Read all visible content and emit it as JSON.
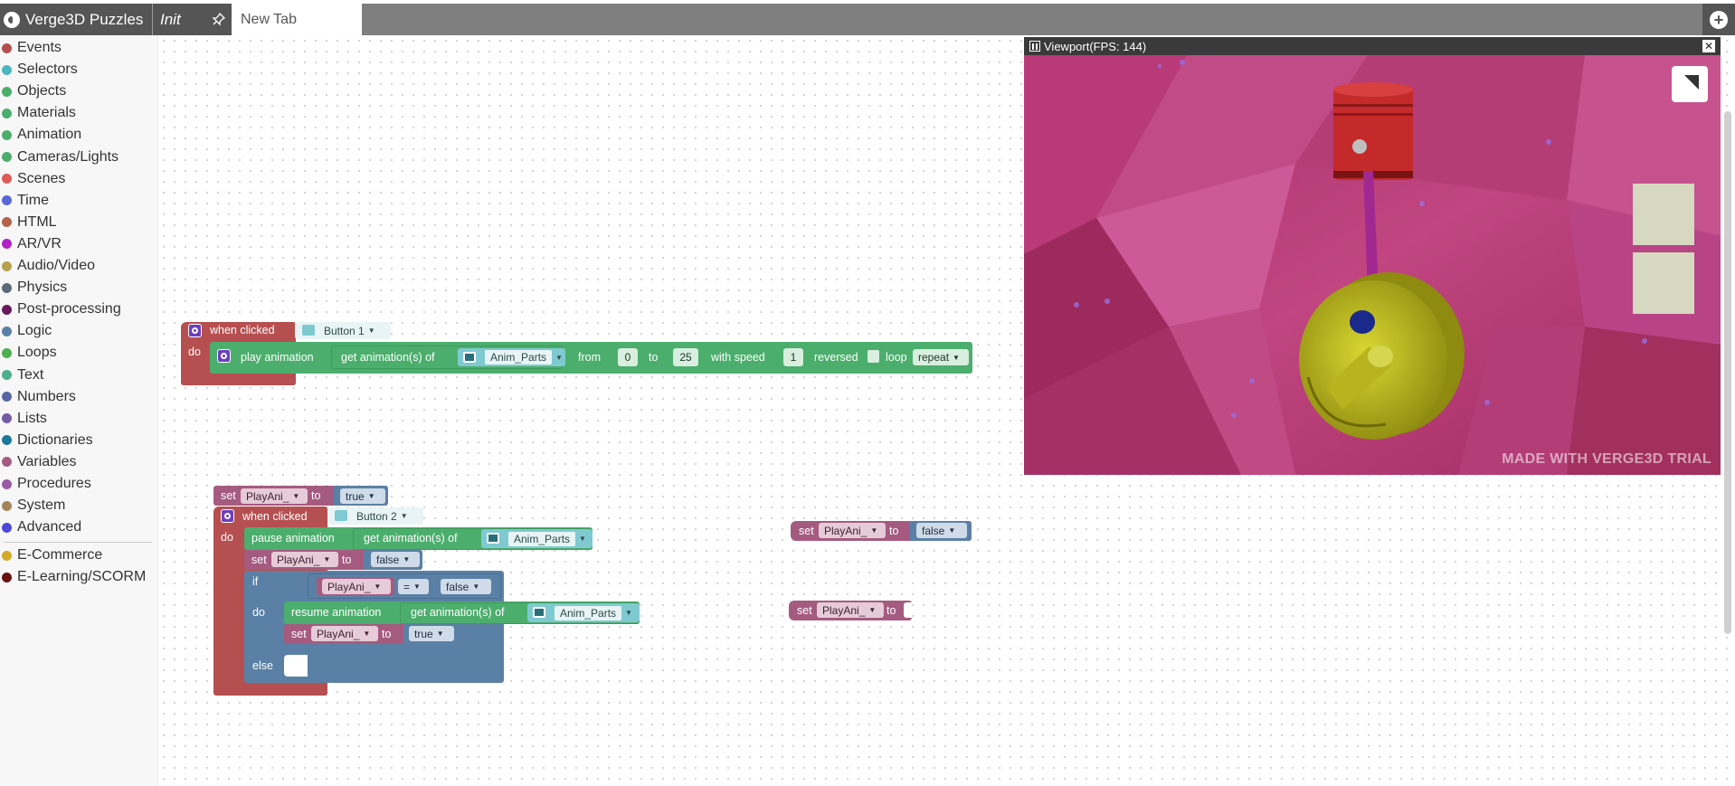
{
  "app": {
    "title": "Verge3D Puzzles",
    "tabs": [
      {
        "label": "Init"
      },
      {
        "label": "New Tab"
      }
    ]
  },
  "sidebar": {
    "categories": [
      {
        "label": "Events",
        "color": "#b64f50"
      },
      {
        "label": "Selectors",
        "color": "#4cb6c0"
      },
      {
        "label": "Objects",
        "color": "#4cae6d"
      },
      {
        "label": "Materials",
        "color": "#4cae6d"
      },
      {
        "label": "Animation",
        "color": "#4cae6d"
      },
      {
        "label": "Cameras/Lights",
        "color": "#4cae6d"
      },
      {
        "label": "Scenes",
        "color": "#e05a5a"
      },
      {
        "label": "Time",
        "color": "#5b67d6"
      },
      {
        "label": "HTML",
        "color": "#b5634a"
      },
      {
        "label": "AR/VR",
        "color": "#b024c4"
      },
      {
        "label": "Audio/Video",
        "color": "#b5a24a"
      },
      {
        "label": "Physics",
        "color": "#5b6a7a"
      },
      {
        "label": "Post-processing",
        "color": "#6a1a5a"
      },
      {
        "label": "Logic",
        "color": "#5b80a5"
      },
      {
        "label": "Loops",
        "color": "#4cae4c"
      },
      {
        "label": "Text",
        "color": "#4cae8c"
      },
      {
        "label": "Numbers",
        "color": "#5b67a5"
      },
      {
        "label": "Lists",
        "color": "#745ba5"
      },
      {
        "label": "Dictionaries",
        "color": "#1a7a9a"
      },
      {
        "label": "Variables",
        "color": "#a55b80"
      },
      {
        "label": "Procedures",
        "color": "#995ba5"
      },
      {
        "label": "System",
        "color": "#a5845b"
      },
      {
        "label": "Advanced",
        "color": "#4a4ad6"
      },
      {
        "label": "E-Commerce",
        "color": "#d4aa2a"
      },
      {
        "label": "E-Learning/SCORM",
        "color": "#6a1010"
      }
    ]
  },
  "blocks": {
    "block1": {
      "when_clicked": "when clicked",
      "object": "Button 1",
      "do": "do",
      "play": "play animation",
      "get_anim": "get animation(s) of",
      "anim_obj": "Anim_Parts",
      "from": "from",
      "from_val": "0",
      "to": "to",
      "to_val": "25",
      "with_speed": "with speed",
      "speed_val": "1",
      "reversed": "reversed",
      "loop": "loop",
      "loop_val": "repeat"
    },
    "block2": {
      "set": "set",
      "var": "PlayAni_",
      "to": "to",
      "init_val": "true",
      "when_clicked": "when clicked",
      "object": "Button 2",
      "do": "do",
      "pause": "pause animation",
      "get_anim": "get animation(s) of",
      "anim_obj": "Anim_Parts",
      "set_false": "false",
      "if": "if",
      "eq": "=",
      "cmp_val": "false",
      "resume": "resume animation",
      "set_true": "true",
      "else": "else"
    },
    "floating1": {
      "set": "set",
      "var": "PlayAni_",
      "to": "to",
      "val": "false"
    },
    "floating2": {
      "set": "set",
      "var": "PlayAni_",
      "to": "to"
    }
  },
  "viewport": {
    "title": "Viewport(FPS: 144)",
    "watermark": "MADE WITH VERGE3D TRIAL"
  }
}
